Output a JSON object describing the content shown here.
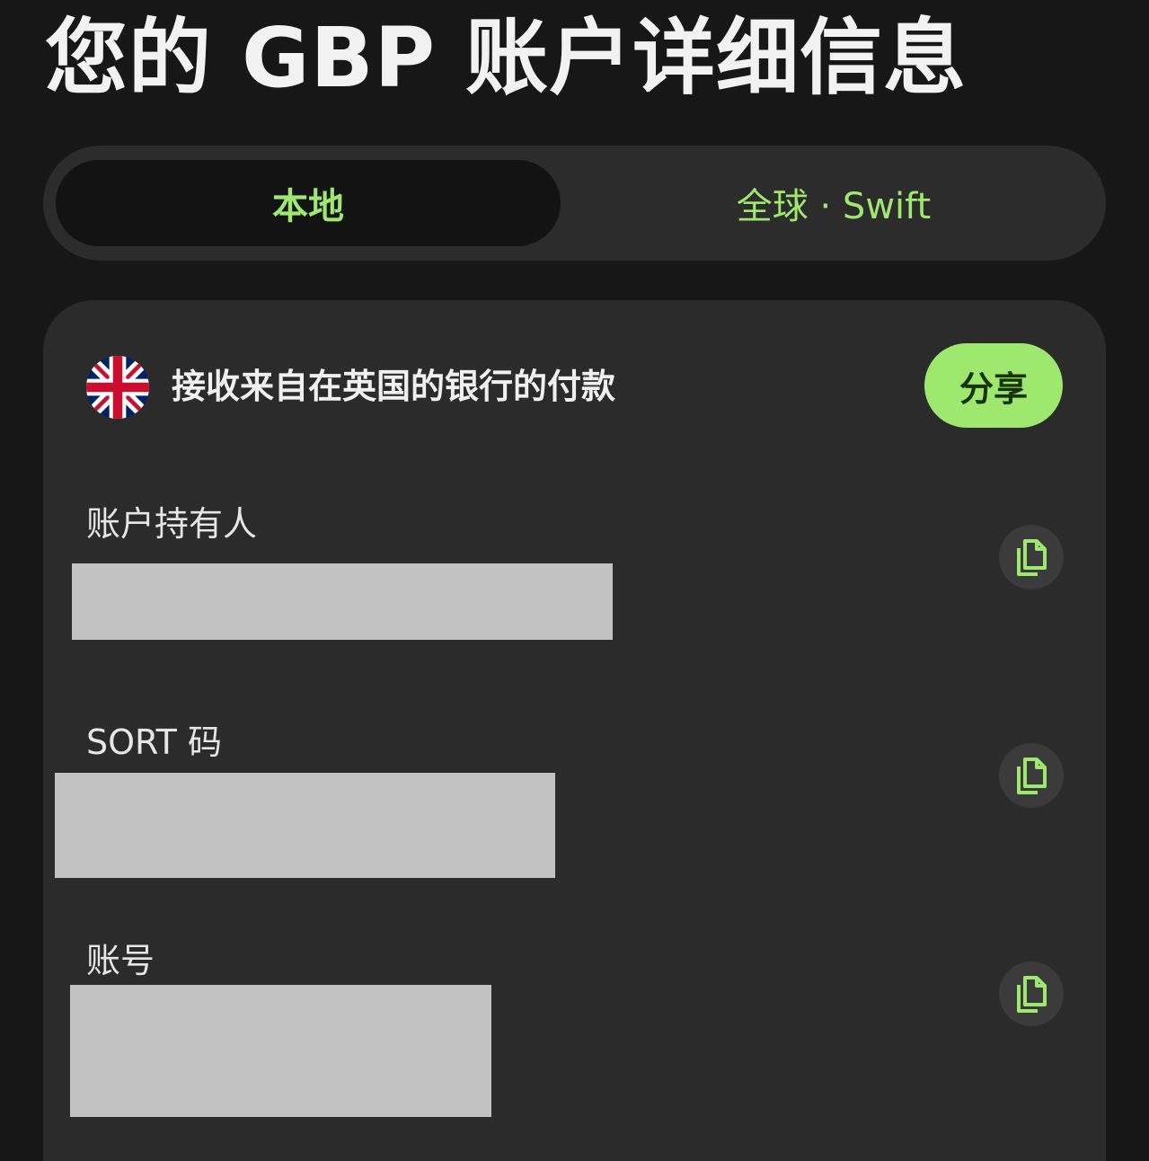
{
  "header": {
    "title": "您的 GBP 账户详细信息"
  },
  "tabs": [
    {
      "label": "本地",
      "active": true
    },
    {
      "label": "全球 · Swift",
      "active": false
    }
  ],
  "card": {
    "flag_icon": "uk-flag-icon",
    "heading": "接收来自在英国的银行的付款",
    "share_label": "分享",
    "fields": [
      {
        "label": "账户持有人",
        "value_redacted": true,
        "copy_icon": "copy-icon"
      },
      {
        "label": "SORT 码",
        "value_redacted": true,
        "copy_icon": "copy-icon"
      },
      {
        "label": "账号",
        "value_redacted": true,
        "copy_icon": "copy-icon"
      }
    ]
  },
  "colors": {
    "background": "#161716",
    "card": "#2a2b2a",
    "accent": "#9fe870",
    "accent_text": "#163300",
    "redaction": "#c2c2c2"
  }
}
